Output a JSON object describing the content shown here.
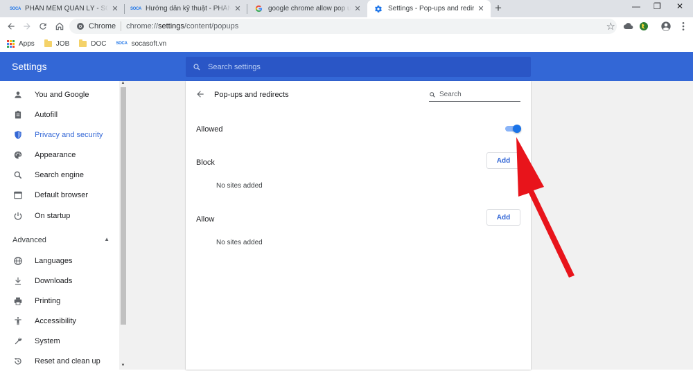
{
  "tabs": [
    {
      "title": "PHẦN MỀM QUẢN LÝ - SOCASOFT",
      "favicon": "socasoft-logo",
      "active": false
    },
    {
      "title": "Hướng dẫn kỹ thuật - PHẦN MỀM",
      "favicon": "socasoft-logo",
      "active": false
    },
    {
      "title": "google chrome allow pop ups - Google",
      "favicon": "google-icon",
      "active": false
    },
    {
      "title": "Settings - Pop-ups and redirects",
      "favicon": "gear-icon",
      "active": true
    }
  ],
  "favicon_text": "SOCA",
  "tab_close_glyph": "✕",
  "new_tab_glyph": "+",
  "window_controls": {
    "minimize": "—",
    "maximize": "❐",
    "close": "✕"
  },
  "omnibox": {
    "scheme_label": "Chrome",
    "url_prefix": "chrome://",
    "url_host": "settings",
    "url_path": "/content/popups"
  },
  "bookmarks": [
    {
      "label": "Apps",
      "icon": "apps-grid-icon"
    },
    {
      "label": "JOB",
      "icon": "folder-icon"
    },
    {
      "label": "DOC",
      "icon": "folder-icon"
    },
    {
      "label": "socasoft.vn",
      "icon": "socasoft-logo"
    }
  ],
  "header": {
    "title": "Settings",
    "search_placeholder": "Search settings"
  },
  "sidebar": {
    "items": [
      {
        "label": "You and Google",
        "icon": "person-icon"
      },
      {
        "label": "Autofill",
        "icon": "clipboard-icon"
      },
      {
        "label": "Privacy and security",
        "icon": "shield-icon",
        "selected": true
      },
      {
        "label": "Appearance",
        "icon": "palette-icon"
      },
      {
        "label": "Search engine",
        "icon": "search-icon"
      },
      {
        "label": "Default browser",
        "icon": "browser-icon"
      },
      {
        "label": "On startup",
        "icon": "power-icon"
      }
    ],
    "advanced_label": "Advanced",
    "advanced_caret": "▲",
    "advanced_items": [
      {
        "label": "Languages",
        "icon": "globe-icon"
      },
      {
        "label": "Downloads",
        "icon": "download-icon"
      },
      {
        "label": "Printing",
        "icon": "printer-icon"
      },
      {
        "label": "Accessibility",
        "icon": "accessibility-icon"
      },
      {
        "label": "System",
        "icon": "wrench-icon"
      },
      {
        "label": "Reset and clean up",
        "icon": "reset-icon"
      }
    ]
  },
  "main": {
    "page_title": "Pop-ups and redirects",
    "search_placeholder": "Search",
    "allowed_label": "Allowed",
    "allowed_toggle_on": true,
    "block_label": "Block",
    "block_add": "Add",
    "block_empty": "No sites added",
    "allow_label": "Allow",
    "allow_add": "Add",
    "allow_empty": "No sites added"
  },
  "colors": {
    "accent": "#3367d6",
    "annotation_arrow": "#e8141b",
    "toggle": "#1a73e8"
  }
}
